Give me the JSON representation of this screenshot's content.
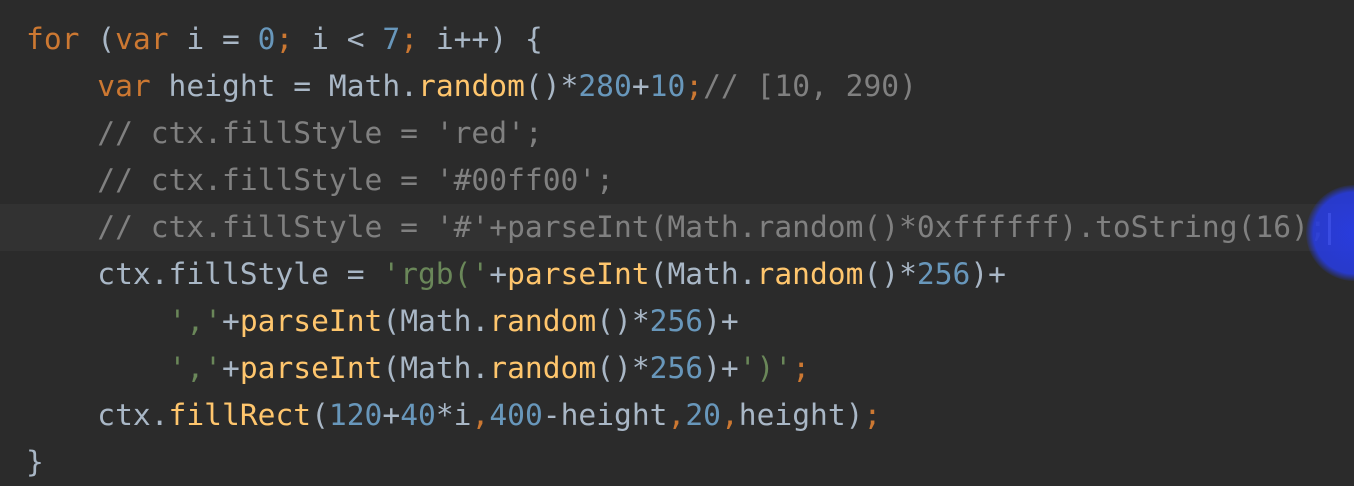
{
  "colors": {
    "background": "#2b2b2b",
    "current_line": "#323232",
    "keyword": "#cc7832",
    "number": "#6897bb",
    "string": "#6a8759",
    "function": "#ffc66d",
    "comment": "#808080",
    "identifier": "#a9b7c6",
    "caret": "#ffffff",
    "cursor_highlight": "#2a3ce6"
  },
  "code_lines": [
    [
      {
        "t": "for",
        "c": "kw"
      },
      {
        "t": " (",
        "c": "id"
      },
      {
        "t": "var",
        "c": "kw"
      },
      {
        "t": " i = ",
        "c": "id"
      },
      {
        "t": "0",
        "c": "num"
      },
      {
        "t": ";",
        "c": "kw"
      },
      {
        "t": " i < ",
        "c": "id"
      },
      {
        "t": "7",
        "c": "num"
      },
      {
        "t": ";",
        "c": "kw"
      },
      {
        "t": " i++) {",
        "c": "id"
      }
    ],
    [
      {
        "t": "    ",
        "c": "id"
      },
      {
        "t": "var",
        "c": "kw"
      },
      {
        "t": " height = Math.",
        "c": "id"
      },
      {
        "t": "random",
        "c": "fn"
      },
      {
        "t": "()*",
        "c": "id"
      },
      {
        "t": "280",
        "c": "num"
      },
      {
        "t": "+",
        "c": "id"
      },
      {
        "t": "10",
        "c": "num"
      },
      {
        "t": ";",
        "c": "kw"
      },
      {
        "t": "// [10, 290)",
        "c": "cmt"
      }
    ],
    [
      {
        "t": "    ",
        "c": "id"
      },
      {
        "t": "// ctx.fillStyle = 'red';",
        "c": "cmt"
      }
    ],
    [
      {
        "t": "    ",
        "c": "id"
      },
      {
        "t": "// ctx.fillStyle = '#00ff00';",
        "c": "cmt"
      }
    ],
    [
      {
        "t": "    ",
        "c": "id"
      },
      {
        "t": "// ctx.fillStyle = '#'+parseInt(Math.random()*0xffffff).toString(16);",
        "c": "cmt"
      }
    ],
    [
      {
        "t": "    ctx.fillStyle = ",
        "c": "id"
      },
      {
        "t": "'rgb('",
        "c": "str"
      },
      {
        "t": "+",
        "c": "id"
      },
      {
        "t": "parseInt",
        "c": "fn"
      },
      {
        "t": "(Math.",
        "c": "id"
      },
      {
        "t": "random",
        "c": "fn"
      },
      {
        "t": "()*",
        "c": "id"
      },
      {
        "t": "256",
        "c": "num"
      },
      {
        "t": ")+",
        "c": "id"
      }
    ],
    [
      {
        "t": "        ",
        "c": "id"
      },
      {
        "t": "','",
        "c": "str"
      },
      {
        "t": "+",
        "c": "id"
      },
      {
        "t": "parseInt",
        "c": "fn"
      },
      {
        "t": "(Math.",
        "c": "id"
      },
      {
        "t": "random",
        "c": "fn"
      },
      {
        "t": "()*",
        "c": "id"
      },
      {
        "t": "256",
        "c": "num"
      },
      {
        "t": ")+",
        "c": "id"
      }
    ],
    [
      {
        "t": "        ",
        "c": "id"
      },
      {
        "t": "','",
        "c": "str"
      },
      {
        "t": "+",
        "c": "id"
      },
      {
        "t": "parseInt",
        "c": "fn"
      },
      {
        "t": "(Math.",
        "c": "id"
      },
      {
        "t": "random",
        "c": "fn"
      },
      {
        "t": "()*",
        "c": "id"
      },
      {
        "t": "256",
        "c": "num"
      },
      {
        "t": ")+",
        "c": "id"
      },
      {
        "t": "')'",
        "c": "str"
      },
      {
        "t": ";",
        "c": "kw"
      }
    ],
    [
      {
        "t": "    ctx.",
        "c": "id"
      },
      {
        "t": "fillRect",
        "c": "fn"
      },
      {
        "t": "(",
        "c": "id"
      },
      {
        "t": "120",
        "c": "num"
      },
      {
        "t": "+",
        "c": "id"
      },
      {
        "t": "40",
        "c": "num"
      },
      {
        "t": "*i",
        "c": "id"
      },
      {
        "t": ",",
        "c": "kw"
      },
      {
        "t": "400",
        "c": "num"
      },
      {
        "t": "-height",
        "c": "id"
      },
      {
        "t": ",",
        "c": "kw"
      },
      {
        "t": "20",
        "c": "num"
      },
      {
        "t": ",",
        "c": "kw"
      },
      {
        "t": "height)",
        "c": "id"
      },
      {
        "t": ";",
        "c": "kw"
      }
    ],
    [
      {
        "t": "}",
        "c": "id"
      }
    ]
  ]
}
